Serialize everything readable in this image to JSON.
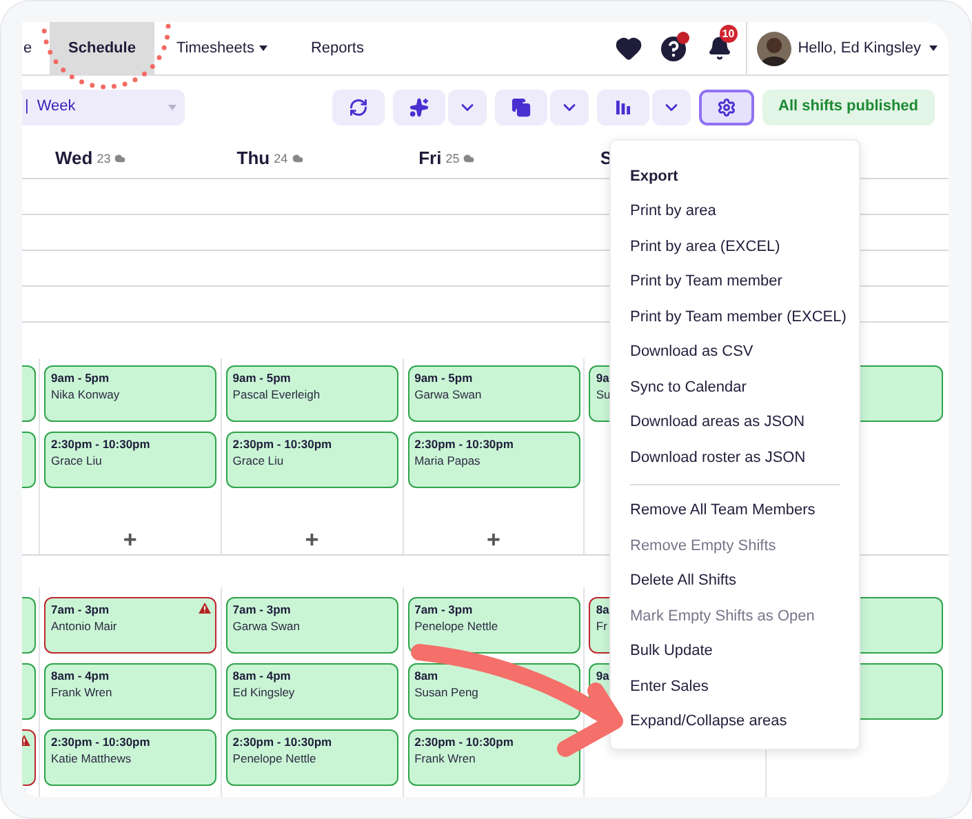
{
  "nav": {
    "tabs": [
      {
        "label": "e",
        "selected": false,
        "dropdown": false
      },
      {
        "label": "Schedule",
        "selected": true,
        "dropdown": false
      },
      {
        "label": "Timesheets",
        "selected": false,
        "dropdown": true
      },
      {
        "label": "Reports",
        "selected": false,
        "dropdown": false
      }
    ],
    "help_alert": true,
    "notifications_badge": "10",
    "user_greeting": "Hello, Ed Kingsley"
  },
  "toolbar": {
    "view_select": {
      "prefix": "|",
      "value": "Week"
    },
    "buttons": [
      {
        "kind": "refresh",
        "selected": false
      },
      {
        "kind": "magic",
        "selected": false
      },
      {
        "kind": "dropdown",
        "selected": false
      },
      {
        "kind": "copy",
        "selected": false
      },
      {
        "kind": "dropdown",
        "selected": false
      },
      {
        "kind": "chart",
        "selected": false
      },
      {
        "kind": "dropdown",
        "selected": false
      },
      {
        "kind": "settings",
        "selected": true
      }
    ],
    "status": "All shifts published"
  },
  "days": [
    {
      "name": "Wed",
      "date": "23"
    },
    {
      "name": "Thu",
      "date": "24"
    },
    {
      "name": "Fri",
      "date": "25"
    },
    {
      "name": "S"
    }
  ],
  "areas": [
    {
      "columns": [
        {
          "shifts": [
            {
              "conflict": false,
              "alert_icon": false
            },
            {
              "conflict": false,
              "alert_icon": false
            }
          ]
        },
        {
          "shifts": [
            {
              "time": "9am - 5pm",
              "name": "Nika Konway",
              "conflict": false,
              "alert_icon": false
            },
            {
              "time": "2:30pm - 10:30pm",
              "name": "Grace Liu",
              "conflict": false,
              "alert_icon": false
            }
          ],
          "add_label": "+"
        },
        {
          "shifts": [
            {
              "time": "9am - 5pm",
              "name": "Pascal Everleigh",
              "conflict": false,
              "alert_icon": false
            },
            {
              "time": "2:30pm - 10:30pm",
              "name": "Grace Liu",
              "conflict": false,
              "alert_icon": false
            }
          ],
          "add_label": "+"
        },
        {
          "shifts": [
            {
              "time": "9am - 5pm",
              "name": "Garwa Swan",
              "conflict": false,
              "alert_icon": false
            },
            {
              "time": "2:30pm - 10:30pm",
              "name": "Maria Papas",
              "conflict": false,
              "alert_icon": false
            }
          ],
          "add_label": "+"
        },
        {
          "shifts": [
            {
              "time": "9a",
              "name": "Su",
              "conflict": false,
              "alert_icon": false
            }
          ]
        },
        {
          "shifts": [
            {
              "conflict": false,
              "alert_icon": false
            }
          ]
        }
      ]
    },
    {
      "columns": [
        {
          "shifts": [
            {
              "conflict": false,
              "alert_icon": false
            },
            {
              "conflict": false,
              "alert_icon": false
            },
            {
              "conflict": true,
              "alert_icon": true
            }
          ]
        },
        {
          "shifts": [
            {
              "time": "7am - 3pm",
              "name": "Antonio Mair",
              "conflict": true,
              "alert_icon": true
            },
            {
              "time": "8am - 4pm",
              "name": "Frank Wren",
              "conflict": false,
              "alert_icon": false
            },
            {
              "time": "2:30pm - 10:30pm",
              "name": "Katie Matthews",
              "conflict": false,
              "alert_icon": false
            }
          ]
        },
        {
          "shifts": [
            {
              "time": "7am - 3pm",
              "name": "Garwa Swan",
              "conflict": false,
              "alert_icon": false
            },
            {
              "time": "8am - 4pm",
              "name": "Ed Kingsley",
              "conflict": false,
              "alert_icon": false
            },
            {
              "time": "2:30pm - 10:30pm",
              "name": "Penelope Nettle",
              "conflict": false,
              "alert_icon": false
            }
          ]
        },
        {
          "shifts": [
            {
              "time": "7am - 3pm",
              "name": "Penelope Nettle",
              "conflict": false,
              "alert_icon": false
            },
            {
              "time": "8am",
              "name": "Susan Peng",
              "conflict": false,
              "alert_icon": false
            },
            {
              "time": "2:30pm - 10:30pm",
              "name": "Frank Wren",
              "conflict": false,
              "alert_icon": false
            }
          ]
        },
        {
          "shifts": [
            {
              "time": "8a",
              "name": "Fr",
              "conflict": true,
              "alert_icon": false
            },
            {
              "time": "9a",
              "conflict": false,
              "alert_icon": false
            }
          ]
        },
        {
          "shifts": [
            {
              "conflict": false,
              "alert_icon": false
            },
            {
              "conflict": false,
              "alert_icon": false
            }
          ]
        }
      ]
    }
  ],
  "menu": {
    "items": [
      {
        "kind": "header",
        "label": "Export"
      },
      {
        "kind": "item",
        "label": "Print by area",
        "disabled": false
      },
      {
        "kind": "item",
        "label": "Print by area (EXCEL)",
        "disabled": false
      },
      {
        "kind": "item",
        "label": "Print by Team member",
        "disabled": false
      },
      {
        "kind": "item",
        "label": "Print by Team member (EXCEL)",
        "disabled": false
      },
      {
        "kind": "item",
        "label": "Download as CSV",
        "disabled": false
      },
      {
        "kind": "item",
        "label": "Sync to Calendar",
        "disabled": false
      },
      {
        "kind": "item",
        "label": "Download areas as JSON",
        "disabled": false
      },
      {
        "kind": "item",
        "label": "Download roster as JSON",
        "disabled": false
      },
      {
        "kind": "divider"
      },
      {
        "kind": "item",
        "label": "Remove All Team Members",
        "disabled": false
      },
      {
        "kind": "item",
        "label": "Remove Empty Shifts",
        "disabled": true
      },
      {
        "kind": "item",
        "label": "Delete All Shifts",
        "disabled": false
      },
      {
        "kind": "item",
        "label": "Mark Empty Shifts as Open",
        "disabled": true
      },
      {
        "kind": "item",
        "label": "Bulk Update",
        "disabled": false
      },
      {
        "kind": "item",
        "label": "Enter Sales",
        "disabled": false
      },
      {
        "kind": "item",
        "label": "Expand/Collapse areas",
        "disabled": false
      }
    ]
  }
}
